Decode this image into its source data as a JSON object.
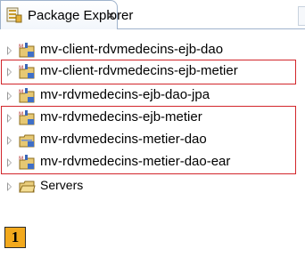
{
  "panel": {
    "title": "Package Explorer",
    "close": "✕"
  },
  "tree": {
    "items": [
      {
        "label": "mv-client-rdvmedecins-ejb-dao",
        "icon": "maven-ejb-project-icon"
      },
      {
        "label": "mv-client-rdvmedecins-ejb-metier",
        "icon": "maven-ejb-project-icon"
      },
      {
        "label": "mv-rdvmedecins-ejb-dao-jpa",
        "icon": "maven-ejb-project-icon"
      },
      {
        "label": "mv-rdvmedecins-ejb-metier",
        "icon": "maven-ejb-project-icon"
      },
      {
        "label": "mv-rdvmedecins-metier-dao",
        "icon": "folder-project-icon"
      },
      {
        "label": "mv-rdvmedecins-metier-dao-ear",
        "icon": "maven-ejb-project-icon"
      },
      {
        "label": "Servers",
        "icon": "folder-icon"
      }
    ]
  },
  "badge": {
    "label": "1"
  },
  "colors": {
    "highlight": "#d2262b",
    "badge": "#f2a91d",
    "tab_border": "#9fb3cc"
  }
}
